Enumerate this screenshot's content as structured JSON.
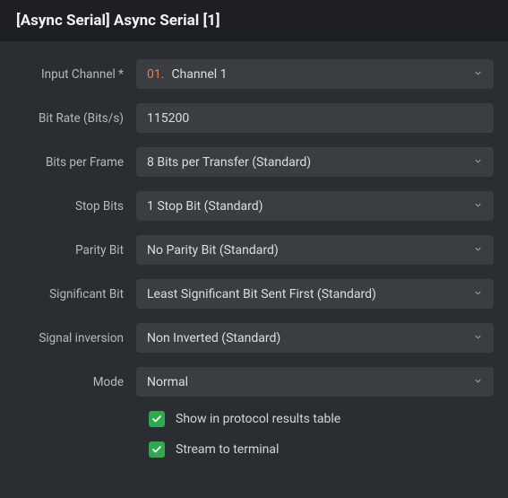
{
  "header": {
    "title": "[Async Serial] Async Serial [1]"
  },
  "fields": {
    "input_channel": {
      "label": "Input Channel *",
      "prefix": "01.",
      "value": "Channel 1"
    },
    "bit_rate": {
      "label": "Bit Rate (Bits/s)",
      "value": "115200"
    },
    "bits_per_frame": {
      "label": "Bits per Frame",
      "value": "8 Bits per Transfer (Standard)"
    },
    "stop_bits": {
      "label": "Stop Bits",
      "value": "1 Stop Bit (Standard)"
    },
    "parity_bit": {
      "label": "Parity Bit",
      "value": "No Parity Bit (Standard)"
    },
    "significant_bit": {
      "label": "Significant Bit",
      "value": "Least Significant Bit Sent First (Standard)"
    },
    "signal_inversion": {
      "label": "Signal inversion",
      "value": "Non Inverted (Standard)"
    },
    "mode": {
      "label": "Mode",
      "value": "Normal"
    }
  },
  "checks": {
    "show_in_results": {
      "label": "Show in protocol results table",
      "checked": true
    },
    "stream_terminal": {
      "label": "Stream to terminal",
      "checked": true
    }
  }
}
